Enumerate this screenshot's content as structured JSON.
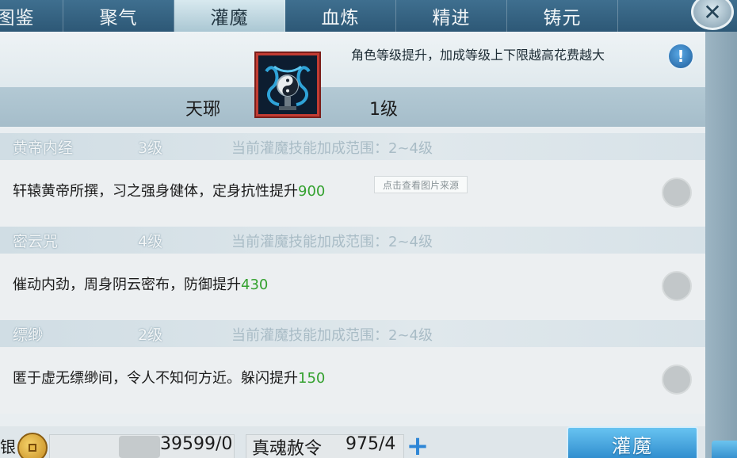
{
  "tabs": [
    {
      "label": "图鉴",
      "active": false
    },
    {
      "label": "聚气",
      "active": false
    },
    {
      "label": "灌魔",
      "active": true
    },
    {
      "label": "血炼",
      "active": false
    },
    {
      "label": "精进",
      "active": false
    },
    {
      "label": "铸元",
      "active": false
    }
  ],
  "header": {
    "hint": "角色等级提升，加成等级上下限越高花费越大",
    "info_icon": "!",
    "close_icon": "✕",
    "skill_name": "天琊",
    "skill_level": "1级"
  },
  "rows": [
    {
      "name": "黄帝内经",
      "level": "3级",
      "range": "当前灌魔技能加成范围：2~4级",
      "desc": "轩辕黄帝所撰，习之强身健体，定身抗性提升",
      "value": "900"
    },
    {
      "name": "密云咒",
      "level": "4级",
      "range": "当前灌魔技能加成范围：2~4级",
      "desc": "催动内劲，周身阴云密布，防御提升",
      "value": "430"
    },
    {
      "name": "缥缈",
      "level": "2级",
      "range": "当前灌魔技能加成范围：2~4级",
      "desc": "匿于虚无缥缈间，令人不知何方近。躲闪提升",
      "value": "150"
    }
  ],
  "watermark": "点击查看图片来源",
  "bottom": {
    "label_cut": "银",
    "money": "39599/0",
    "soul_label": "真魂赦令",
    "soul_count": "975/4",
    "plus": "+",
    "action": "灌魔"
  },
  "colors": {
    "value_green": "#34a12f",
    "accent_blue": "#2f8ccd",
    "tab_bar": "#2d5876"
  }
}
